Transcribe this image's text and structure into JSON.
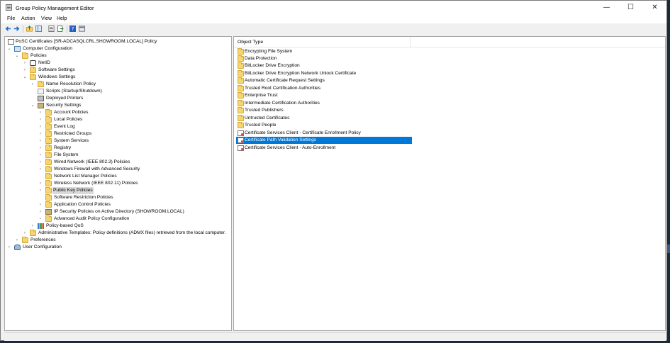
{
  "window": {
    "title": "Group Policy Management Editor",
    "minimize_glyph": "—",
    "maximize_glyph": "☐",
    "close_glyph": "✕"
  },
  "menu": [
    "File",
    "Action",
    "View",
    "Help"
  ],
  "toolbar": {
    "buttons": [
      "back-icon",
      "forward-icon",
      "up-folder-icon",
      "show-hide-tree-icon",
      "properties-icon",
      "export-list-icon",
      "help-icon",
      "mmc-icon"
    ]
  },
  "tree": {
    "items": [
      {
        "label": "PoSC Certificates [SR-ADCASQLCRL.SHOWROOM.LOCAL] Policy",
        "icon": "policy-icon"
      },
      {
        "label": "Computer Configuration",
        "icon": "computer-icon"
      },
      {
        "label": "Policies",
        "icon": "folder-icon"
      },
      {
        "label": "NetID",
        "icon": "netid-icon"
      },
      {
        "label": "Software Settings",
        "icon": "folder-icon"
      },
      {
        "label": "Windows Settings",
        "icon": "folder-icon"
      },
      {
        "label": "Name Resolution Policy",
        "icon": "folder-icon"
      },
      {
        "label": "Scripts (Startup/Shutdown)",
        "icon": "scroll-icon"
      },
      {
        "label": "Deployed Printers",
        "icon": "printer-icon"
      },
      {
        "label": "Security Settings",
        "icon": "security-icon"
      },
      {
        "label": "Account Policies",
        "icon": "folder-icon"
      },
      {
        "label": "Local Policies",
        "icon": "folder-icon"
      },
      {
        "label": "Event Log",
        "icon": "folder-icon"
      },
      {
        "label": "Restricted Groups",
        "icon": "folder-icon"
      },
      {
        "label": "System Services",
        "icon": "folder-icon"
      },
      {
        "label": "Registry",
        "icon": "folder-icon"
      },
      {
        "label": "File System",
        "icon": "folder-icon"
      },
      {
        "label": "Wired Network (IEEE 802.3) Policies",
        "icon": "folder-icon"
      },
      {
        "label": "Windows Firewall with Advanced Security",
        "icon": "folder-icon"
      },
      {
        "label": "Network List Manager Policies",
        "icon": "folder-icon"
      },
      {
        "label": "Wireless Network (IEEE 802.11) Policies",
        "icon": "folder-icon"
      },
      {
        "label": "Public Key Policies",
        "icon": "folder-icon"
      },
      {
        "label": "Software Restriction Policies",
        "icon": "folder-icon"
      },
      {
        "label": "Application Control Policies",
        "icon": "folder-icon"
      },
      {
        "label": "IP Security Policies on Active Directory (SHOWROOM.LOCAL)",
        "icon": "ip-security-icon"
      },
      {
        "label": "Advanced Audit Policy Configuration",
        "icon": "folder-icon"
      },
      {
        "label": "Policy-based QoS",
        "icon": "qos-chart-icon"
      },
      {
        "label": "Administrative Templates: Policy definitions (ADMX files) retrieved from the local computer.",
        "icon": "folder-icon"
      },
      {
        "label": "Preferences",
        "icon": "folder-icon"
      },
      {
        "label": "User Configuration",
        "icon": "user-icon"
      }
    ]
  },
  "list": {
    "column_header": "Object Type",
    "items": [
      {
        "label": "Encrypting File System",
        "icon": "folder-icon"
      },
      {
        "label": "Data Protection",
        "icon": "folder-icon"
      },
      {
        "label": "BitLocker Drive Encryption",
        "icon": "folder-icon"
      },
      {
        "label": "BitLocker Drive Encryption Network Unlock Certificate",
        "icon": "folder-icon"
      },
      {
        "label": "Automatic Certificate Request Settings",
        "icon": "folder-icon"
      },
      {
        "label": "Trusted Root Certification Authorities",
        "icon": "folder-icon"
      },
      {
        "label": "Enterprise Trust",
        "icon": "folder-icon"
      },
      {
        "label": "Intermediate Certification Authorities",
        "icon": "folder-icon"
      },
      {
        "label": "Trusted Publishers",
        "icon": "folder-icon"
      },
      {
        "label": "Untrusted Certificates",
        "icon": "folder-icon"
      },
      {
        "label": "Trusted People",
        "icon": "folder-icon"
      },
      {
        "label": "Certificate Services Client - Certificate Enrollment Policy",
        "icon": "certificate-icon"
      },
      {
        "label": "Certificate Path Validation Settings",
        "icon": "certificate-icon"
      },
      {
        "label": "Certificate Services Client - Auto-Enrollment",
        "icon": "certificate-icon"
      }
    ]
  },
  "colors": {
    "selection": "#0078d7",
    "folder": "#f5d56f",
    "tree_selected": "#d9d9d9"
  }
}
